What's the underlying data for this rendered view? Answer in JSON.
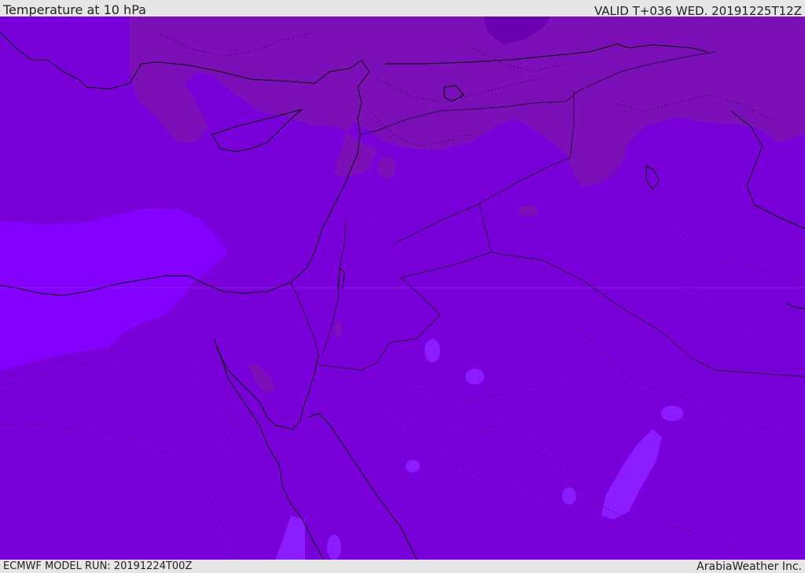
{
  "header": {
    "title": "Temperature at 10 hPa",
    "valid": "VALID T+036 WED. 20191225T12Z"
  },
  "footer": {
    "model_run": "ECMWF MODEL RUN: 20191224T00Z",
    "credit": "ArabiaWeather Inc."
  },
  "map": {
    "colors": {
      "base": "#7a00da",
      "cold_northern_band": "#7c10b8",
      "coldest_patch": "#6a00b0",
      "warm_mediterranean": "#8400ff",
      "warm_spots": "#8a1cff",
      "coastline": "#000000",
      "borders": "#2a0040"
    }
  }
}
